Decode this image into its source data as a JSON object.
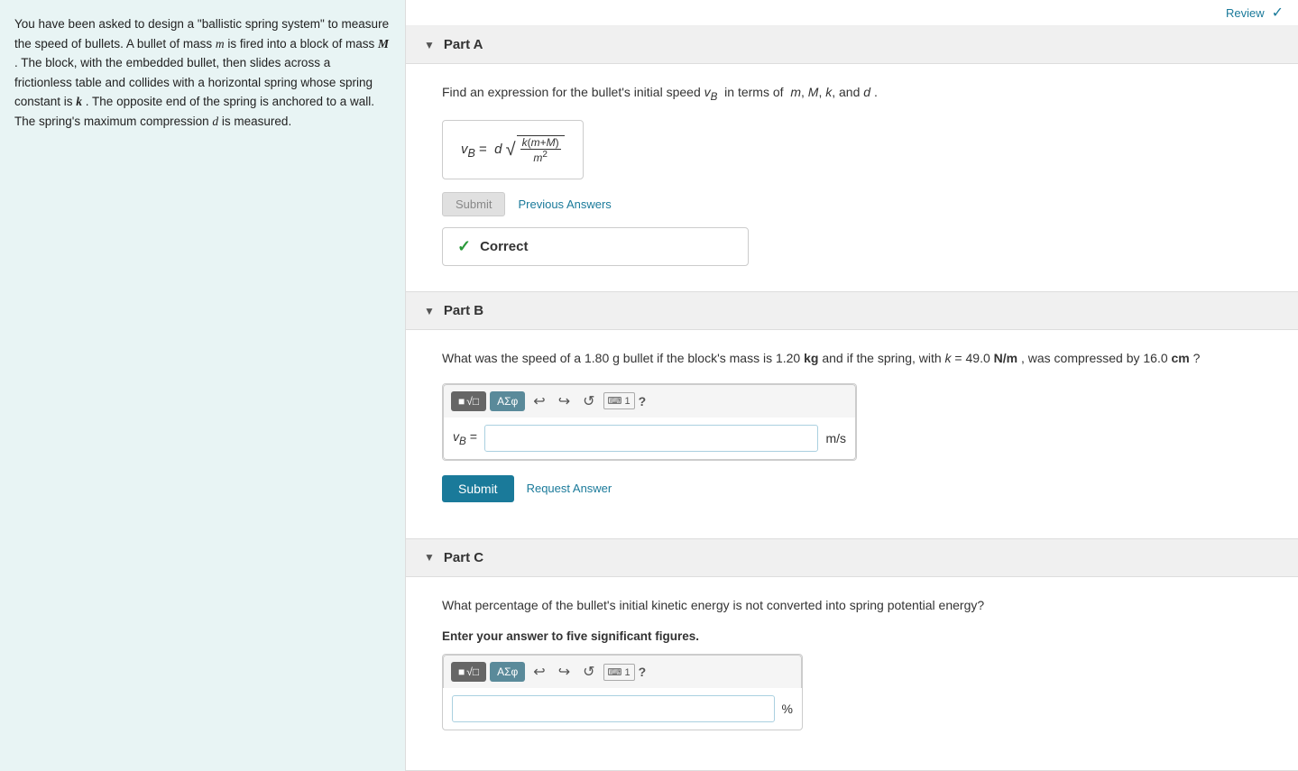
{
  "topbar": {
    "review_label": "Review",
    "check_symbol": "✓"
  },
  "left_panel": {
    "text": "You have been asked to design a \"ballistic spring system\" to measure the speed of bullets. A bullet of mass m is fired into a block of mass M . The block, with the embedded bullet, then slides across a frictionless table and collides with a horizontal spring whose spring constant is k . The opposite end of the spring is anchored to a wall. The spring's maximum compression d is measured."
  },
  "part_a": {
    "title": "Part A",
    "question": "Find an expression for the bullet's initial speed",
    "variable": "v_B",
    "in_terms": "in terms of",
    "variables_list": "m, M, k, and d .",
    "formula_display": "v_B = d√(k(m+M)/m²)",
    "submit_label": "Submit",
    "previous_answers_label": "Previous Answers",
    "correct_label": "Correct"
  },
  "part_b": {
    "title": "Part B",
    "question": "What was the speed of a 1.80 g bullet if the block's mass is 1.20 kg and if the spring, with k = 49.0 N/m , was compressed by 16.0 cm ?",
    "input_label": "v_B =",
    "unit": "m/s",
    "submit_label": "Submit",
    "request_answer_label": "Request Answer",
    "toolbar": {
      "sqrt_label": "√□",
      "symbol_label": "ΑΣφ",
      "undo_symbol": "↺",
      "redo_symbol": "↻",
      "reset_symbol": "⟳",
      "keyboard_symbol": "⌨1",
      "help_symbol": "?"
    }
  },
  "part_c": {
    "title": "Part C",
    "question": "What percentage of the bullet's initial kinetic energy is not converted into spring potential energy?",
    "note": "Enter your answer to five significant figures.",
    "unit": "%",
    "toolbar": {
      "sqrt_label": "√□",
      "symbol_label": "ΑΣφ",
      "undo_symbol": "↺",
      "redo_symbol": "↻",
      "reset_symbol": "⟳",
      "keyboard_symbol": "⌨1",
      "help_symbol": "?"
    }
  }
}
